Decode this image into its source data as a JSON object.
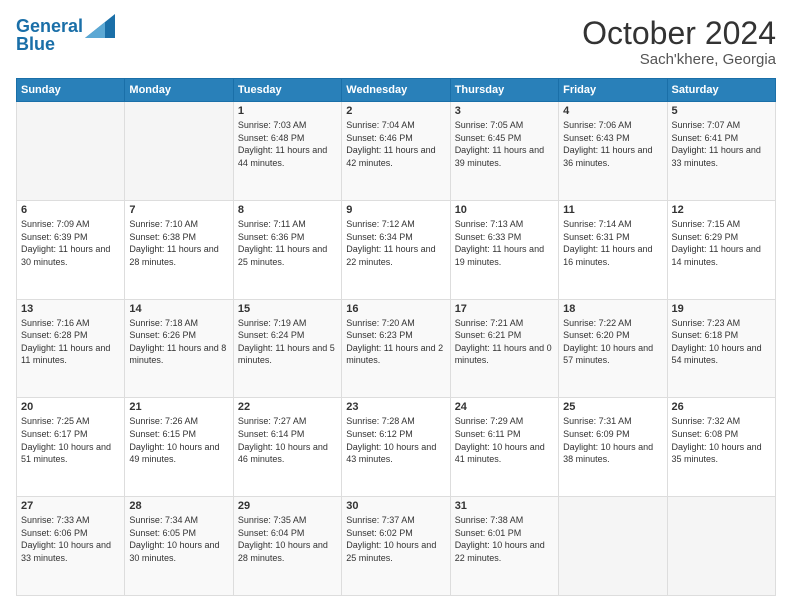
{
  "header": {
    "logo_line1": "General",
    "logo_line2": "Blue",
    "title": "October 2024",
    "subtitle": "Sach'khere, Georgia"
  },
  "weekdays": [
    "Sunday",
    "Monday",
    "Tuesday",
    "Wednesday",
    "Thursday",
    "Friday",
    "Saturday"
  ],
  "weeks": [
    [
      {
        "day": "",
        "info": ""
      },
      {
        "day": "",
        "info": ""
      },
      {
        "day": "1",
        "info": "Sunrise: 7:03 AM\nSunset: 6:48 PM\nDaylight: 11 hours and 44 minutes."
      },
      {
        "day": "2",
        "info": "Sunrise: 7:04 AM\nSunset: 6:46 PM\nDaylight: 11 hours and 42 minutes."
      },
      {
        "day": "3",
        "info": "Sunrise: 7:05 AM\nSunset: 6:45 PM\nDaylight: 11 hours and 39 minutes."
      },
      {
        "day": "4",
        "info": "Sunrise: 7:06 AM\nSunset: 6:43 PM\nDaylight: 11 hours and 36 minutes."
      },
      {
        "day": "5",
        "info": "Sunrise: 7:07 AM\nSunset: 6:41 PM\nDaylight: 11 hours and 33 minutes."
      }
    ],
    [
      {
        "day": "6",
        "info": "Sunrise: 7:09 AM\nSunset: 6:39 PM\nDaylight: 11 hours and 30 minutes."
      },
      {
        "day": "7",
        "info": "Sunrise: 7:10 AM\nSunset: 6:38 PM\nDaylight: 11 hours and 28 minutes."
      },
      {
        "day": "8",
        "info": "Sunrise: 7:11 AM\nSunset: 6:36 PM\nDaylight: 11 hours and 25 minutes."
      },
      {
        "day": "9",
        "info": "Sunrise: 7:12 AM\nSunset: 6:34 PM\nDaylight: 11 hours and 22 minutes."
      },
      {
        "day": "10",
        "info": "Sunrise: 7:13 AM\nSunset: 6:33 PM\nDaylight: 11 hours and 19 minutes."
      },
      {
        "day": "11",
        "info": "Sunrise: 7:14 AM\nSunset: 6:31 PM\nDaylight: 11 hours and 16 minutes."
      },
      {
        "day": "12",
        "info": "Sunrise: 7:15 AM\nSunset: 6:29 PM\nDaylight: 11 hours and 14 minutes."
      }
    ],
    [
      {
        "day": "13",
        "info": "Sunrise: 7:16 AM\nSunset: 6:28 PM\nDaylight: 11 hours and 11 minutes."
      },
      {
        "day": "14",
        "info": "Sunrise: 7:18 AM\nSunset: 6:26 PM\nDaylight: 11 hours and 8 minutes."
      },
      {
        "day": "15",
        "info": "Sunrise: 7:19 AM\nSunset: 6:24 PM\nDaylight: 11 hours and 5 minutes."
      },
      {
        "day": "16",
        "info": "Sunrise: 7:20 AM\nSunset: 6:23 PM\nDaylight: 11 hours and 2 minutes."
      },
      {
        "day": "17",
        "info": "Sunrise: 7:21 AM\nSunset: 6:21 PM\nDaylight: 11 hours and 0 minutes."
      },
      {
        "day": "18",
        "info": "Sunrise: 7:22 AM\nSunset: 6:20 PM\nDaylight: 10 hours and 57 minutes."
      },
      {
        "day": "19",
        "info": "Sunrise: 7:23 AM\nSunset: 6:18 PM\nDaylight: 10 hours and 54 minutes."
      }
    ],
    [
      {
        "day": "20",
        "info": "Sunrise: 7:25 AM\nSunset: 6:17 PM\nDaylight: 10 hours and 51 minutes."
      },
      {
        "day": "21",
        "info": "Sunrise: 7:26 AM\nSunset: 6:15 PM\nDaylight: 10 hours and 49 minutes."
      },
      {
        "day": "22",
        "info": "Sunrise: 7:27 AM\nSunset: 6:14 PM\nDaylight: 10 hours and 46 minutes."
      },
      {
        "day": "23",
        "info": "Sunrise: 7:28 AM\nSunset: 6:12 PM\nDaylight: 10 hours and 43 minutes."
      },
      {
        "day": "24",
        "info": "Sunrise: 7:29 AM\nSunset: 6:11 PM\nDaylight: 10 hours and 41 minutes."
      },
      {
        "day": "25",
        "info": "Sunrise: 7:31 AM\nSunset: 6:09 PM\nDaylight: 10 hours and 38 minutes."
      },
      {
        "day": "26",
        "info": "Sunrise: 7:32 AM\nSunset: 6:08 PM\nDaylight: 10 hours and 35 minutes."
      }
    ],
    [
      {
        "day": "27",
        "info": "Sunrise: 7:33 AM\nSunset: 6:06 PM\nDaylight: 10 hours and 33 minutes."
      },
      {
        "day": "28",
        "info": "Sunrise: 7:34 AM\nSunset: 6:05 PM\nDaylight: 10 hours and 30 minutes."
      },
      {
        "day": "29",
        "info": "Sunrise: 7:35 AM\nSunset: 6:04 PM\nDaylight: 10 hours and 28 minutes."
      },
      {
        "day": "30",
        "info": "Sunrise: 7:37 AM\nSunset: 6:02 PM\nDaylight: 10 hours and 25 minutes."
      },
      {
        "day": "31",
        "info": "Sunrise: 7:38 AM\nSunset: 6:01 PM\nDaylight: 10 hours and 22 minutes."
      },
      {
        "day": "",
        "info": ""
      },
      {
        "day": "",
        "info": ""
      }
    ]
  ]
}
